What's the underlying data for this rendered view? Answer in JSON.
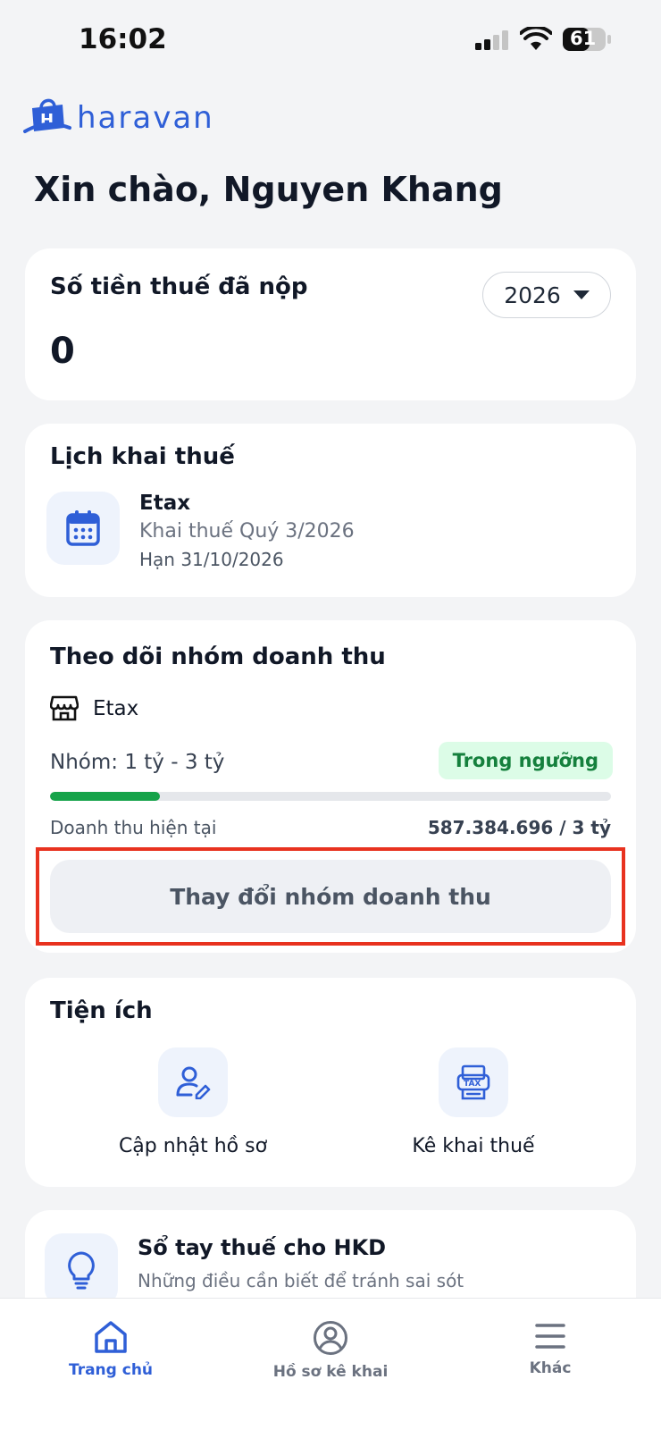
{
  "status_bar": {
    "time": "16:02",
    "battery": "61"
  },
  "brand": {
    "name": "haravan",
    "color": "#2f5fd7"
  },
  "greeting": "Xin chào, Nguyen Khang",
  "tax_paid": {
    "title": "Số tiền thuế đã nộp",
    "year": "2026",
    "amount": "0"
  },
  "schedule": {
    "title": "Lịch khai thuế",
    "icon": "calendar-icon",
    "name": "Etax",
    "subtitle": "Khai thuế Quý 3/2026",
    "deadline": "Hạn 31/10/2026"
  },
  "revenue": {
    "title": "Theo dõi nhóm doanh thu",
    "store_icon": "store-icon",
    "store": "Etax",
    "group": "Nhóm: 1 tỷ - 3 tỷ",
    "status": "Trong ngưỡng",
    "status_color": "#15803d",
    "progress_fraction": 0.196,
    "current_label": "Doanh thu hiện tại",
    "current_value": "587.384.696 / 3 tỷ",
    "change_button": "Thay đổi nhóm doanh thu",
    "highlight_color": "#e8321f"
  },
  "utilities": {
    "title": "Tiện ích",
    "items": [
      {
        "label": "Cập nhật hồ sơ",
        "icon": "user-edit-icon"
      },
      {
        "label": "Kê khai thuế",
        "icon": "tax-document-icon"
      }
    ]
  },
  "handbook": {
    "icon": "lightbulb-icon",
    "title": "Sổ tay thuế cho HKD",
    "subtitle": "Những điều cần biết để tránh sai sót trong quá trình kê khai"
  },
  "nav": {
    "items": [
      {
        "label": "Trang chủ",
        "icon": "home-icon",
        "active": true
      },
      {
        "label": "Hồ sơ kê khai",
        "icon": "profile-icon",
        "active": false
      },
      {
        "label": "Khác",
        "icon": "menu-icon",
        "active": false
      }
    ]
  }
}
